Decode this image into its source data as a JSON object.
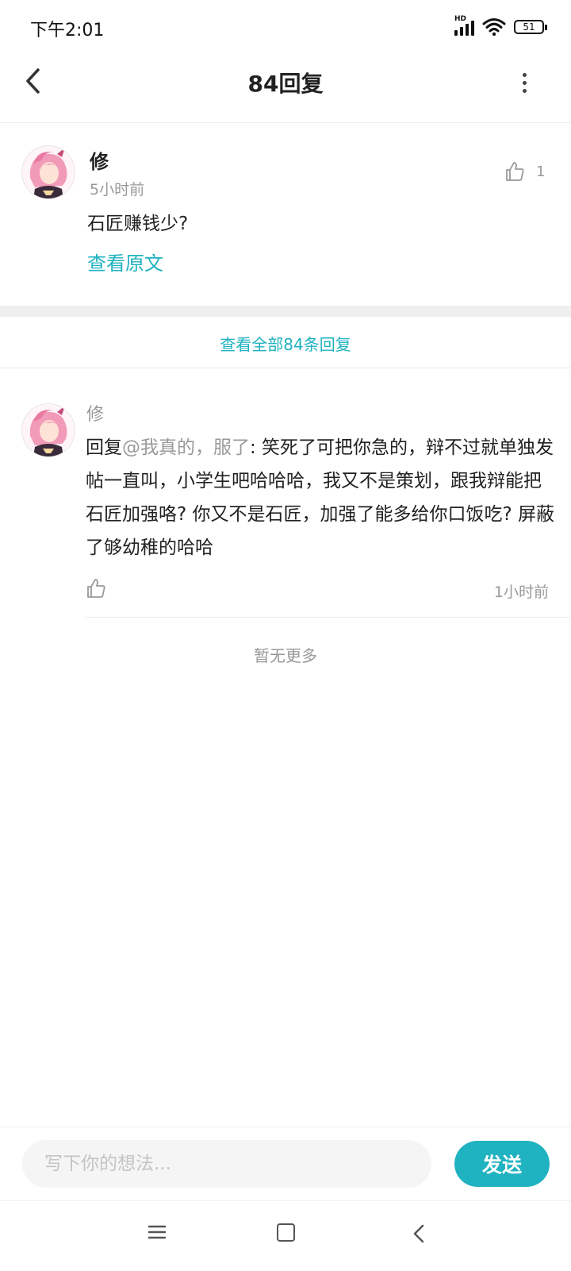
{
  "status_bar": {
    "time": "下午2:01",
    "network": "HD",
    "battery": "51"
  },
  "header": {
    "title": "84回复"
  },
  "post": {
    "author": "修",
    "time": "5小时前",
    "like_count": "1",
    "content": "石匠赚钱少?",
    "view_original": "查看原文"
  },
  "view_all_label": "查看全部84条回复",
  "reply": {
    "author": "修",
    "prefix": "回复",
    "mention": "@我真的，服了",
    "body": ": 笑死了可把你急的，辩不过就单独发帖一直叫，小学生吧哈哈哈，我又不是策划，跟我辩能把石匠加强咯? 你又不是石匠，加强了能多给你口饭吃? 屏蔽了够幼稚的哈哈",
    "time": "1小时前"
  },
  "no_more": "暂无更多",
  "composer": {
    "placeholder": "写下你的想法...",
    "send_label": "发送"
  },
  "colors": {
    "accent": "#1fb2c0",
    "muted_text": "#999999"
  },
  "icons": [
    "back-chevron-icon",
    "more-vertical-icon",
    "thumbs-up-icon",
    "menu-icon",
    "home-square-icon",
    "nav-back-icon"
  ]
}
